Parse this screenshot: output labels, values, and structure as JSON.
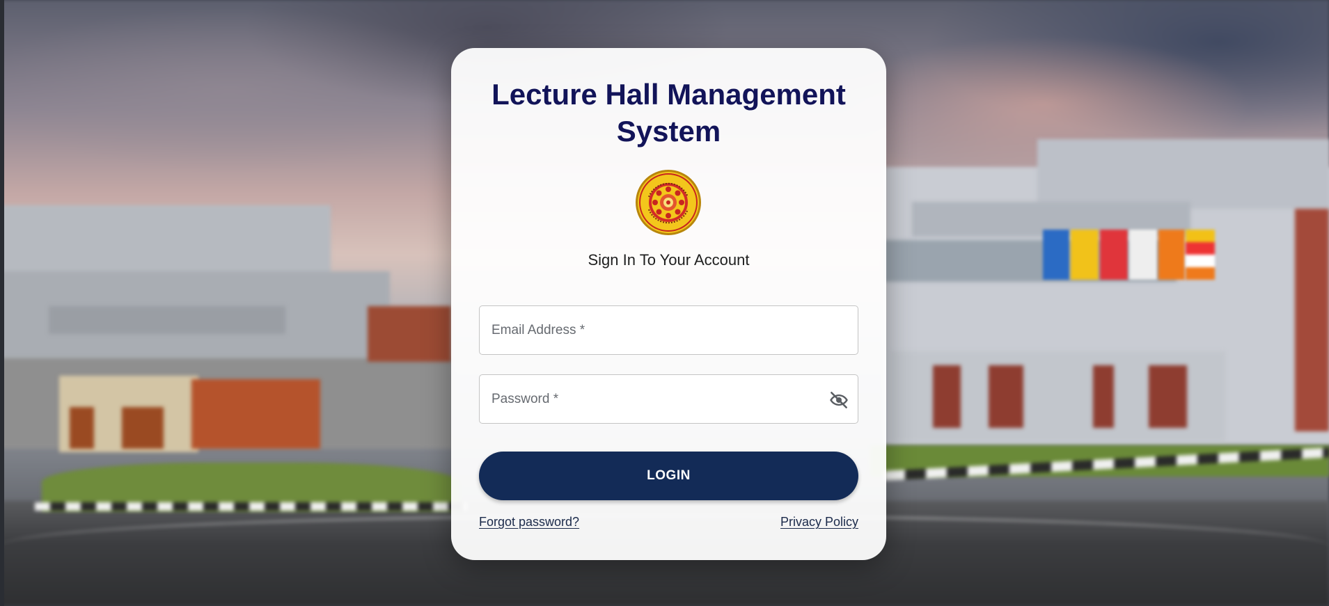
{
  "app": {
    "title": "Lecture Hall Management System",
    "subtitle": "Sign In To Your Account"
  },
  "logo": {
    "icon": "university-seal-icon",
    "colors": {
      "outer": "#e0b316",
      "ring": "#d32b27",
      "center": "#f3c61c"
    }
  },
  "form": {
    "email": {
      "placeholder": "Email Address *",
      "value": ""
    },
    "password": {
      "placeholder": "Password *",
      "value": "",
      "toggle_icon": "eye-off-icon"
    },
    "login_label": "LOGIN",
    "forgot_label": "Forgot password?",
    "privacy_label": "Privacy Policy"
  },
  "theme": {
    "title_color": "#121459",
    "button_color": "#132b57"
  }
}
